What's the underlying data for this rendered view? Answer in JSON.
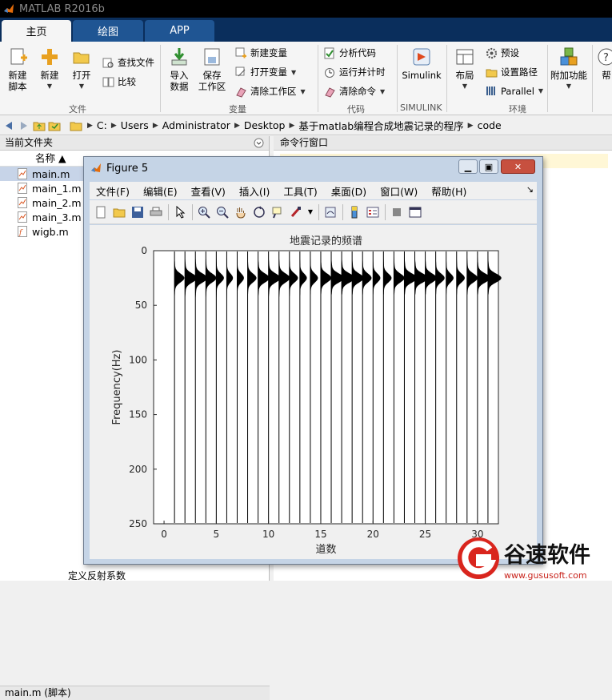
{
  "app": {
    "title": "MATLAB R2016b"
  },
  "tabs": [
    {
      "label": "主页"
    },
    {
      "label": "绘图"
    },
    {
      "label": "APP"
    }
  ],
  "ribbon": {
    "file": {
      "new_script": "新建\n脚本",
      "new": "新建",
      "open": "打开",
      "find_files": "查找文件",
      "compare": "比较",
      "group": "文件"
    },
    "variable": {
      "import": "导入\n数据",
      "save_ws": "保存\n工作区",
      "new_var": "新建变量",
      "open_var": "打开变量",
      "clear_ws": "清除工作区",
      "group": "变量"
    },
    "code": {
      "analyze": "分析代码",
      "run_time": "运行并计时",
      "clear_cmd": "清除命令",
      "group": "代码"
    },
    "simulink": {
      "label": "Simulink",
      "group": "SIMULINK"
    },
    "env": {
      "layout": "布局",
      "prefs": "预设",
      "set_path": "设置路径",
      "parallel": "Parallel",
      "group": "环境"
    },
    "addons": {
      "label": "附加功能"
    },
    "help": {
      "label": "帮"
    }
  },
  "address": {
    "crumbs": [
      "C:",
      "Users",
      "Administrator",
      "Desktop",
      "基于matlab编程合成地震记录的程序",
      "code"
    ]
  },
  "current_folder": {
    "title": "当前文件夹",
    "col_name": "名称 ▲",
    "files": [
      {
        "name": "main.m"
      },
      {
        "name": "main_1.m"
      },
      {
        "name": "main_2.m"
      },
      {
        "name": "main_3.m"
      },
      {
        "name": "wigb.m"
      }
    ],
    "detail": "main.m  (脚本)",
    "bottom_text": "定义反射系数"
  },
  "command_window": {
    "title": "命令行窗口"
  },
  "figure": {
    "title": "Figure 5",
    "menus": [
      "文件(F)",
      "编辑(E)",
      "查看(V)",
      "插入(I)",
      "工具(T)",
      "桌面(D)",
      "窗口(W)",
      "帮助(H)"
    ]
  },
  "chart_data": {
    "type": "wiggle",
    "title": "地震记录的频谱",
    "xlabel": "道数",
    "ylabel": "Frequency(Hz)",
    "xlim": [
      -1,
      32
    ],
    "ylim": [
      250,
      0
    ],
    "xticks": [
      0,
      5,
      10,
      15,
      20,
      25,
      30
    ],
    "yticks": [
      0,
      50,
      100,
      150,
      200,
      250
    ],
    "traces": [
      1,
      2,
      3,
      4,
      5,
      6,
      7,
      8,
      9,
      10,
      11,
      12,
      13,
      14,
      15,
      16,
      17,
      18,
      19,
      20,
      21,
      22,
      23,
      24,
      25,
      26,
      27,
      28,
      29,
      30,
      31
    ],
    "peak_frequency": [
      25,
      25,
      25,
      25,
      25,
      25,
      25,
      25,
      25,
      25,
      25,
      25,
      25,
      25,
      25,
      25,
      25,
      25,
      25,
      25,
      25,
      25,
      25,
      25,
      25,
      25,
      25,
      25,
      25,
      25,
      25
    ],
    "band_end_frequency": [
      60,
      58,
      56,
      54,
      52,
      50,
      48,
      46,
      45,
      44,
      43,
      42,
      41,
      40,
      40,
      40,
      40,
      40,
      40,
      40,
      40,
      40,
      40,
      40,
      40,
      40,
      40,
      40,
      40,
      40,
      40
    ],
    "peak_amplitude": [
      0.9,
      0.9,
      0.85,
      0.85,
      0.8,
      0.8,
      0.8,
      0.8,
      0.85,
      0.85,
      0.9,
      0.9,
      0.9,
      0.9,
      0.95,
      0.95,
      0.95,
      0.95,
      0.95,
      0.95,
      0.95,
      0.95,
      0.95,
      0.95,
      0.95,
      0.95,
      0.95,
      0.95,
      0.95,
      0.95,
      0.95
    ],
    "grid": false
  },
  "watermark": {
    "text": "谷速软件",
    "url": "www.gususoft.com",
    "brand_color": "#d9251d"
  }
}
